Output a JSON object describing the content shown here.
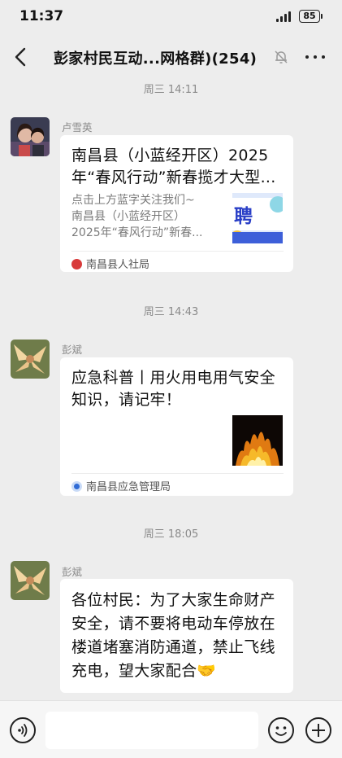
{
  "status_bar": {
    "time": "11:37",
    "battery": "85"
  },
  "header": {
    "title": "彭家村民互动...网格群)(254)"
  },
  "messages": [
    {
      "timestamp": "周三 14:11",
      "sender": "卢雪英",
      "card": {
        "title": "南昌县（小蓝经开区）2025年“春风行动”新春揽才大型...",
        "desc_lines": [
          "点击上方蓝字关注我们~",
          "南昌县（小蓝经开区）",
          "2025年“春风行动”新春..."
        ],
        "thumb_text": "聘",
        "source": "南昌县人社局"
      }
    },
    {
      "timestamp": "周三 14:43",
      "sender": "彭斌",
      "card": {
        "title": "应急科普丨用火用电用气安全知识，请记牢！",
        "source": "南昌县应急管理局"
      }
    },
    {
      "timestamp": "周三 18:05",
      "sender": "彭斌",
      "text": "各位村民：为了大家生命财产安全，请不要将电动车停放在楼道堵塞消防通道，禁止飞线充电，望大家配合🤝"
    }
  ],
  "input_bar": {
    "placeholder": ""
  },
  "colors": {
    "background": "#ededed",
    "bubble": "#ffffff",
    "meta_text": "#8a8a8a"
  }
}
